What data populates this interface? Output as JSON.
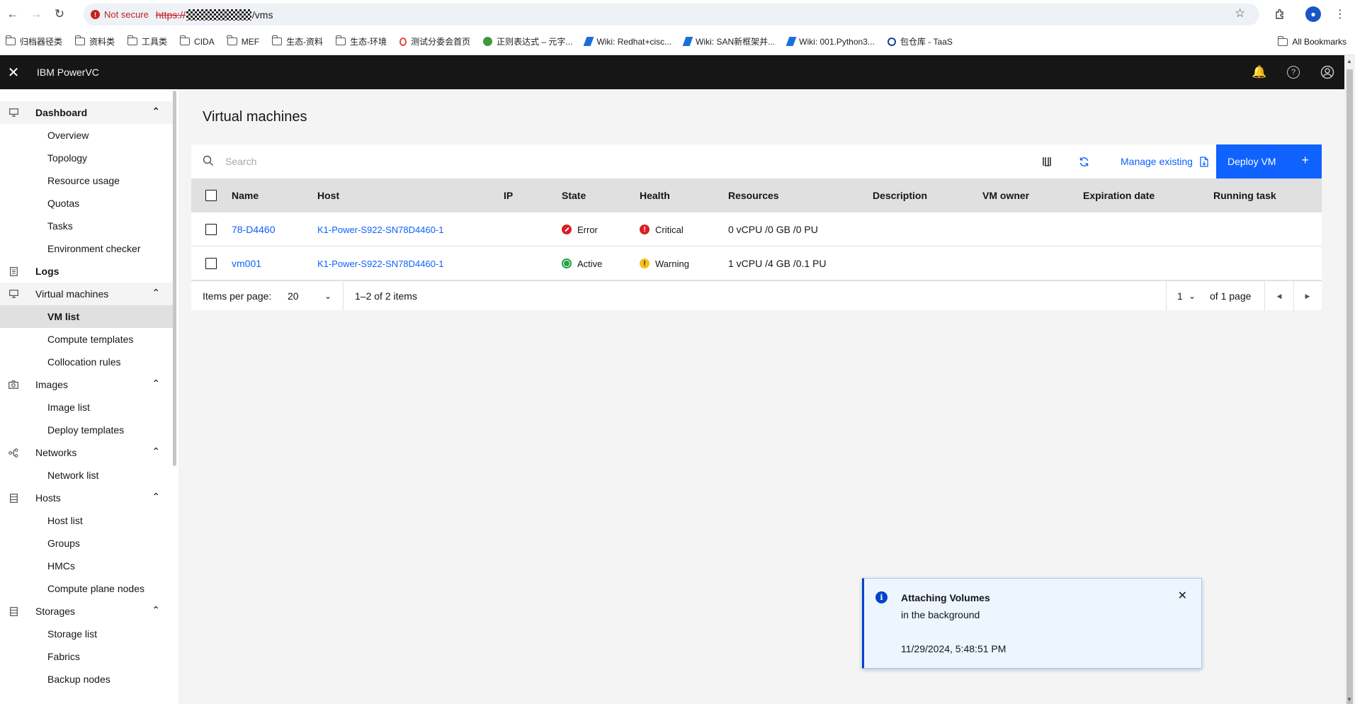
{
  "browser": {
    "security_label": "Not secure",
    "url_scheme": "https://",
    "url_path": "/vms",
    "bookmarks": [
      "归档器径类",
      "资料类",
      "工具类",
      "CIDA",
      "MEF",
      "生态-资料",
      "生态-环境",
      "测试分委会首页",
      "正则表达式 – 元字...",
      "Wiki: Redhat+cisc...",
      "Wiki: SAN新框架并...",
      "Wiki: 001.Python3...",
      "包仓库 - TaaS"
    ],
    "all_bookmarks": "All Bookmarks"
  },
  "app": {
    "title": "IBM PowerVC"
  },
  "sidebar": {
    "dashboard": "Dashboard",
    "overview": "Overview",
    "topology": "Topology",
    "resource_usage": "Resource usage",
    "quotas": "Quotas",
    "tasks": "Tasks",
    "environment_checker": "Environment checker",
    "logs": "Logs",
    "virtual_machines": "Virtual machines",
    "vm_list": "VM list",
    "compute_templates": "Compute templates",
    "collocation_rules": "Collocation rules",
    "images": "Images",
    "image_list": "Image list",
    "deploy_templates": "Deploy templates",
    "networks": "Networks",
    "network_list": "Network list",
    "hosts": "Hosts",
    "host_list": "Host list",
    "groups": "Groups",
    "hmcs": "HMCs",
    "compute_plane_nodes": "Compute plane nodes",
    "storages": "Storages",
    "storage_list": "Storage list",
    "fabrics": "Fabrics",
    "backup_nodes": "Backup nodes"
  },
  "main": {
    "title": "Virtual machines",
    "search_placeholder": "Search",
    "manage_existing": "Manage existing",
    "deploy_vm": "Deploy VM",
    "columns": {
      "name": "Name",
      "host": "Host",
      "ip": "IP",
      "state": "State",
      "health": "Health",
      "resources": "Resources",
      "description": "Description",
      "vm_owner": "VM owner",
      "expiration_date": "Expiration date",
      "running_task": "Running task"
    },
    "rows": [
      {
        "name": "78-D4460",
        "host": "K1-Power-S922-SN78D4460-1",
        "ip": "",
        "state": "Error",
        "health": "Critical",
        "resources": "0 vCPU /0 GB /0 PU"
      },
      {
        "name": "vm001",
        "host": "K1-Power-S922-SN78D4460-1",
        "ip": "",
        "state": "Active",
        "health": "Warning",
        "resources": "1 vCPU /4 GB /0.1 PU"
      }
    ],
    "pagination": {
      "items_per_page_label": "Items per page:",
      "items_per_page": "20",
      "range": "1–2 of 2 items",
      "page": "1",
      "page_total": "of 1 page"
    }
  },
  "notification": {
    "title": "Attaching Volumes",
    "subtitle": "in the background",
    "timestamp": "11/29/2024, 5:48:51 PM"
  },
  "colors": {
    "primary": "#0f62fe",
    "header": "#161616",
    "error": "#da1e28",
    "success": "#24a148",
    "warning": "#f1c21b"
  }
}
